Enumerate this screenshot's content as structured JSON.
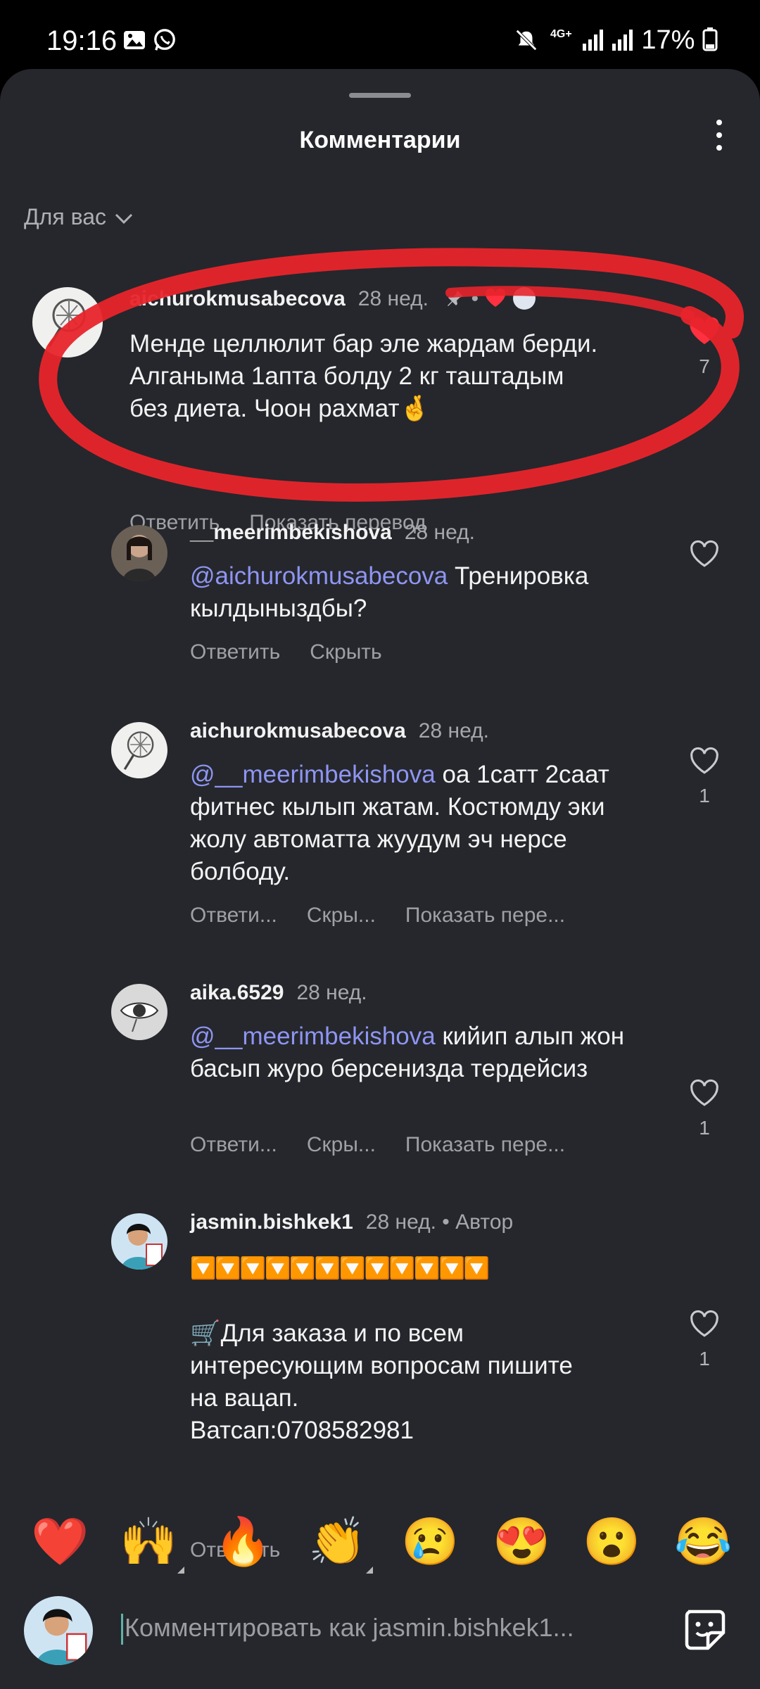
{
  "status_bar": {
    "time": "19:16",
    "network": "4G+",
    "battery": "17%"
  },
  "header": {
    "title": "Комментарии",
    "filter_label": "Для вас"
  },
  "comments": [
    {
      "username": "aichurokmusabecova",
      "time": "28 нед.",
      "text": "Менде целлюлит бар эле жардам берди. Алганыма 1апта болду 2 кг таштадым без диета. Чоон рахмат🤞",
      "actions": [
        "Ответить",
        "Показать перевод"
      ],
      "likes": "7",
      "liked": true
    },
    {
      "username": "__meerimbekishova",
      "time": "28 нед.",
      "mention": "@aichurokmusabecova",
      "text": "Тренировка кылдыныздбы?",
      "actions": [
        "Ответить",
        "Скрыть"
      ],
      "likes": ""
    },
    {
      "username": "aichurokmusabecova",
      "time": "28 нед.",
      "mention": "@__meerimbekishova",
      "text": "оа 1сатт 2саат фитнес кылып жатам. Костюмду  эки жолу  автоматта жуудум эч нерсе болбоду.",
      "actions": [
        "Ответи...",
        "Скры...",
        "Показать пере..."
      ],
      "likes": "1"
    },
    {
      "username": "aika.6529",
      "time": "28 нед.",
      "mention": "@__meerimbekishova",
      "text": "кийип алып жон басып журо берсенизда тердейсиз",
      "actions": [
        "Ответи...",
        "Скры...",
        "Показать пере..."
      ],
      "likes": "1"
    },
    {
      "username": "jasmin.bishkek1",
      "time": "28 нед.",
      "author_badge": "Автор",
      "arrows": "🔽🔽🔽🔽🔽🔽🔽🔽🔽🔽🔽🔽",
      "text_lines": [
        "🛒Для заказа и по  всем",
        "интересующим вопросам пишите",
        "на вацап.",
        "Ватсап:0708582981"
      ],
      "actions": [
        "Ответить"
      ],
      "likes": "1"
    }
  ],
  "emoji_bar": [
    "❤️",
    "🙌",
    "🔥",
    "👏",
    "😢",
    "😍",
    "😮",
    "😂"
  ],
  "composer": {
    "placeholder": "Комментировать как jasmin.bishkek1..."
  },
  "colors": {
    "sheet": "#25272c",
    "mention": "#8e95f2",
    "like_red": "#ff3040",
    "annotation": "#e8242b"
  }
}
